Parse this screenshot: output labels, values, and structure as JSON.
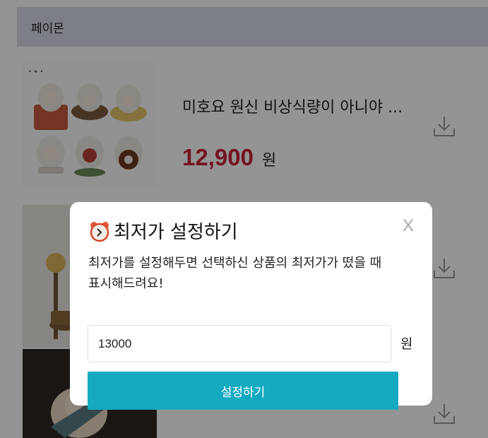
{
  "header": {
    "title": "페이몬"
  },
  "product": {
    "title": "미호요 원신 비상식량이 아니야 ...",
    "price": "12,900",
    "price_unit": "원"
  },
  "modal": {
    "title": "최저가 설정하기",
    "close_label": "X",
    "description_line1": "최저가를 설정해두면 선택하신 상품의 최저가가 떴을 때",
    "description_line2": "표시해드려요!",
    "input_value": "13000",
    "currency_unit": "원",
    "submit_label": "설정하기"
  },
  "colors": {
    "price": "#c8223b",
    "accent_button": "#16aac0",
    "header_bg": "#d8dbe7"
  },
  "icons": [
    "download-icon",
    "clock-icon",
    "close-icon"
  ]
}
